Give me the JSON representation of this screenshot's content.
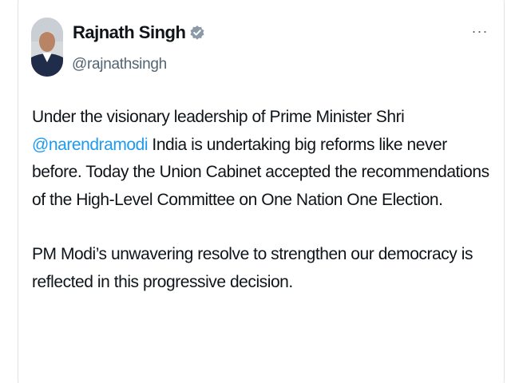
{
  "author": {
    "name": "Rajnath Singh",
    "handle": "@rajnathsingh",
    "verified": true,
    "verified_icon": "verified-badge-icon",
    "badge_color": "#8b98a5"
  },
  "menu": {
    "more_label": "···",
    "more_icon": "more-options-icon"
  },
  "tweet": {
    "paragraph1": {
      "before_mention": "Under the visionary leadership of Prime Minister Shri ",
      "mention": "@narendramodi",
      "after_mention": " India is undertaking big reforms like never before. Today the Union Cabinet accepted the recommendations of the High-Level Committee on One Nation One Election."
    },
    "paragraph2": "PM Modi’s unwavering resolve to strengthen our democracy is reflected in this progressive decision."
  },
  "colors": {
    "text": "#0f1419",
    "secondary": "#536471",
    "link": "#1d9bf0",
    "border": "#dfe3e6"
  }
}
